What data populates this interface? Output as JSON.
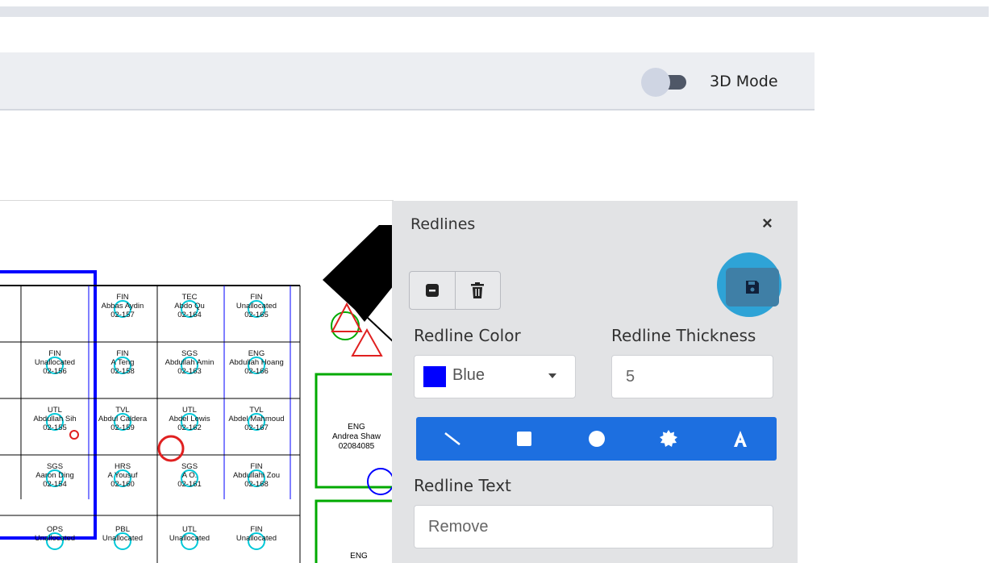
{
  "toolbar": {
    "mode_label": "3D Mode"
  },
  "map": {
    "rooms": [
      {
        "dept": "FIN",
        "name": "Abbas Aydin",
        "num": "02-157"
      },
      {
        "dept": "TEC",
        "name": "Abdo Qu",
        "num": "02-164"
      },
      {
        "dept": "FIN",
        "name": "Unallocated",
        "num": "02-165"
      },
      {
        "dept": "FIN",
        "name": "Unallocated",
        "num": "02-156"
      },
      {
        "dept": "FIN",
        "name": "A Teng",
        "num": "02-158"
      },
      {
        "dept": "SGS",
        "name": "Abdullah Amin",
        "num": "02-163"
      },
      {
        "dept": "ENG",
        "name": "Abdullah Hoang",
        "num": "02-166"
      },
      {
        "dept": "UTL",
        "name": "Abdullah Sih",
        "num": "02-155"
      },
      {
        "dept": "TVL",
        "name": "Abdul Caldera",
        "num": "02-159"
      },
      {
        "dept": "UTL",
        "name": "Abdel Lewis",
        "num": "02-162"
      },
      {
        "dept": "TVL",
        "name": "Abdel Mahmoud",
        "num": "02-167"
      },
      {
        "dept": "SGS",
        "name": "Aaron Ding",
        "num": "02-154"
      },
      {
        "dept": "HRS",
        "name": "A Yousuf",
        "num": "02-160"
      },
      {
        "dept": "SGS",
        "name": "A O.",
        "num": "02-161"
      },
      {
        "dept": "FIN",
        "name": "Abdullahi Zou",
        "num": "02-168"
      },
      {
        "dept": "OPS",
        "name": "Unallocated",
        "num": ""
      },
      {
        "dept": "PBL",
        "name": "Unallocated",
        "num": ""
      },
      {
        "dept": "UTL",
        "name": "Unallocated",
        "num": ""
      },
      {
        "dept": "FIN",
        "name": "Unallocated",
        "num": ""
      }
    ],
    "eng_office": {
      "dept": "ENG",
      "name": "Andrea Shaw",
      "num": "02084085"
    },
    "eng_office2": {
      "dept": "ENG"
    }
  },
  "panel": {
    "title": "Redlines",
    "close": "×",
    "color_label": "Redline Color",
    "color_value": "Blue",
    "color_hex": "#0000ff",
    "thickness_label": "Redline Thickness",
    "thickness_value": "5",
    "text_label": "Redline Text",
    "text_value": "Remove",
    "icons": {
      "minus": "minus-square-icon",
      "delete": "trash-icon",
      "save": "floppy-disk-icon",
      "shapes": [
        "line-icon",
        "square-icon",
        "circle-icon",
        "burst-icon",
        "text-icon"
      ]
    },
    "accent": "#1d6fe0"
  }
}
